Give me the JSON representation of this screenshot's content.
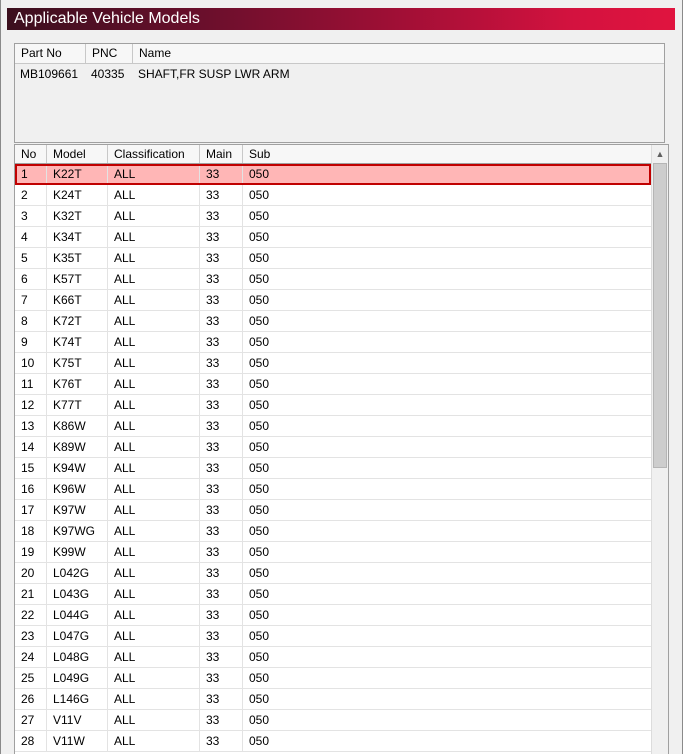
{
  "window": {
    "title": "Applicable Vehicle Models"
  },
  "part": {
    "headers": {
      "part_no": "Part No",
      "pnc": "PNC",
      "name": "Name"
    },
    "values": {
      "part_no": "MB109661",
      "pnc": "40335",
      "name": "SHAFT,FR SUSP LWR ARM"
    }
  },
  "grid": {
    "headers": {
      "no": "No",
      "model": "Model",
      "classification": "Classification",
      "main": "Main",
      "sub": "Sub"
    },
    "selected_index": 0,
    "rows": [
      {
        "no": "1",
        "model": "K22T",
        "classification": "ALL",
        "main": "33",
        "sub": "050"
      },
      {
        "no": "2",
        "model": "K24T",
        "classification": "ALL",
        "main": "33",
        "sub": "050"
      },
      {
        "no": "3",
        "model": "K32T",
        "classification": "ALL",
        "main": "33",
        "sub": "050"
      },
      {
        "no": "4",
        "model": "K34T",
        "classification": "ALL",
        "main": "33",
        "sub": "050"
      },
      {
        "no": "5",
        "model": "K35T",
        "classification": "ALL",
        "main": "33",
        "sub": "050"
      },
      {
        "no": "6",
        "model": "K57T",
        "classification": "ALL",
        "main": "33",
        "sub": "050"
      },
      {
        "no": "7",
        "model": "K66T",
        "classification": "ALL",
        "main": "33",
        "sub": "050"
      },
      {
        "no": "8",
        "model": "K72T",
        "classification": "ALL",
        "main": "33",
        "sub": "050"
      },
      {
        "no": "9",
        "model": "K74T",
        "classification": "ALL",
        "main": "33",
        "sub": "050"
      },
      {
        "no": "10",
        "model": "K75T",
        "classification": "ALL",
        "main": "33",
        "sub": "050"
      },
      {
        "no": "11",
        "model": "K76T",
        "classification": "ALL",
        "main": "33",
        "sub": "050"
      },
      {
        "no": "12",
        "model": "K77T",
        "classification": "ALL",
        "main": "33",
        "sub": "050"
      },
      {
        "no": "13",
        "model": "K86W",
        "classification": "ALL",
        "main": "33",
        "sub": "050"
      },
      {
        "no": "14",
        "model": "K89W",
        "classification": "ALL",
        "main": "33",
        "sub": "050"
      },
      {
        "no": "15",
        "model": "K94W",
        "classification": "ALL",
        "main": "33",
        "sub": "050"
      },
      {
        "no": "16",
        "model": "K96W",
        "classification": "ALL",
        "main": "33",
        "sub": "050"
      },
      {
        "no": "17",
        "model": "K97W",
        "classification": "ALL",
        "main": "33",
        "sub": "050"
      },
      {
        "no": "18",
        "model": "K97WG",
        "classification": "ALL",
        "main": "33",
        "sub": "050"
      },
      {
        "no": "19",
        "model": "K99W",
        "classification": "ALL",
        "main": "33",
        "sub": "050"
      },
      {
        "no": "20",
        "model": "L042G",
        "classification": "ALL",
        "main": "33",
        "sub": "050"
      },
      {
        "no": "21",
        "model": "L043G",
        "classification": "ALL",
        "main": "33",
        "sub": "050"
      },
      {
        "no": "22",
        "model": "L044G",
        "classification": "ALL",
        "main": "33",
        "sub": "050"
      },
      {
        "no": "23",
        "model": "L047G",
        "classification": "ALL",
        "main": "33",
        "sub": "050"
      },
      {
        "no": "24",
        "model": "L048G",
        "classification": "ALL",
        "main": "33",
        "sub": "050"
      },
      {
        "no": "25",
        "model": "L049G",
        "classification": "ALL",
        "main": "33",
        "sub": "050"
      },
      {
        "no": "26",
        "model": "L146G",
        "classification": "ALL",
        "main": "33",
        "sub": "050"
      },
      {
        "no": "27",
        "model": "V11V",
        "classification": "ALL",
        "main": "33",
        "sub": "050"
      },
      {
        "no": "28",
        "model": "V11W",
        "classification": "ALL",
        "main": "33",
        "sub": "050"
      }
    ]
  },
  "scrollbar": {
    "up_icon": "scroll-up-arrow-icon"
  }
}
